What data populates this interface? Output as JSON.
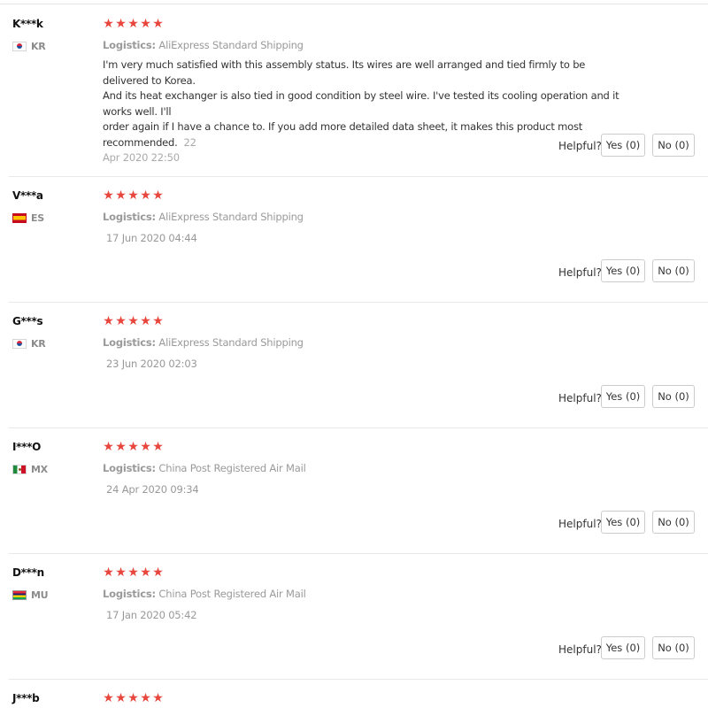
{
  "helpful_label": "Helpful?",
  "star_glyph": "★",
  "star_color": "#e8453c",
  "reviews": [
    {
      "user": "K***k",
      "country_code": "KR",
      "stars": 5,
      "logistics_label": "Logistics:",
      "logistics_value": "AliExpress Standard Shipping",
      "content_lines": [
        "I'm very much satisfied with this assembly status. Its wires are well arranged and tied firmly to be delivered to Korea.",
        "And its heat exchanger is also tied in good condition by steel wire. I've tested its cooling operation and it works well. I'll",
        "order again if I have a chance to. If you add more detailed data sheet, it makes this product most recommended."
      ],
      "date_part1": "22",
      "date_part2": "Apr 2020 22:50",
      "yes": "Yes (0)",
      "no": "No (0)"
    },
    {
      "user": "V***a",
      "country_code": "ES",
      "stars": 5,
      "logistics_label": "Logistics:",
      "logistics_value": "AliExpress Standard Shipping",
      "date": "17 Jun 2020 04:44",
      "yes": "Yes (0)",
      "no": "No (0)"
    },
    {
      "user": "G***s",
      "country_code": "KR",
      "stars": 5,
      "logistics_label": "Logistics:",
      "logistics_value": "AliExpress Standard Shipping",
      "date": "23 Jun 2020 02:03",
      "yes": "Yes (0)",
      "no": "No (0)"
    },
    {
      "user": "I***O",
      "country_code": "MX",
      "stars": 5,
      "logistics_label": "Logistics:",
      "logistics_value": "China Post Registered Air Mail",
      "date": "24 Apr 2020 09:34",
      "yes": "Yes (0)",
      "no": "No (0)"
    },
    {
      "user": "D***n",
      "country_code": "MU",
      "stars": 5,
      "logistics_label": "Logistics:",
      "logistics_value": "China Post Registered Air Mail",
      "date": "17 Jan 2020 05:42",
      "yes": "Yes (0)",
      "no": "No (0)"
    },
    {
      "user": "J***b",
      "stars": 5
    }
  ]
}
